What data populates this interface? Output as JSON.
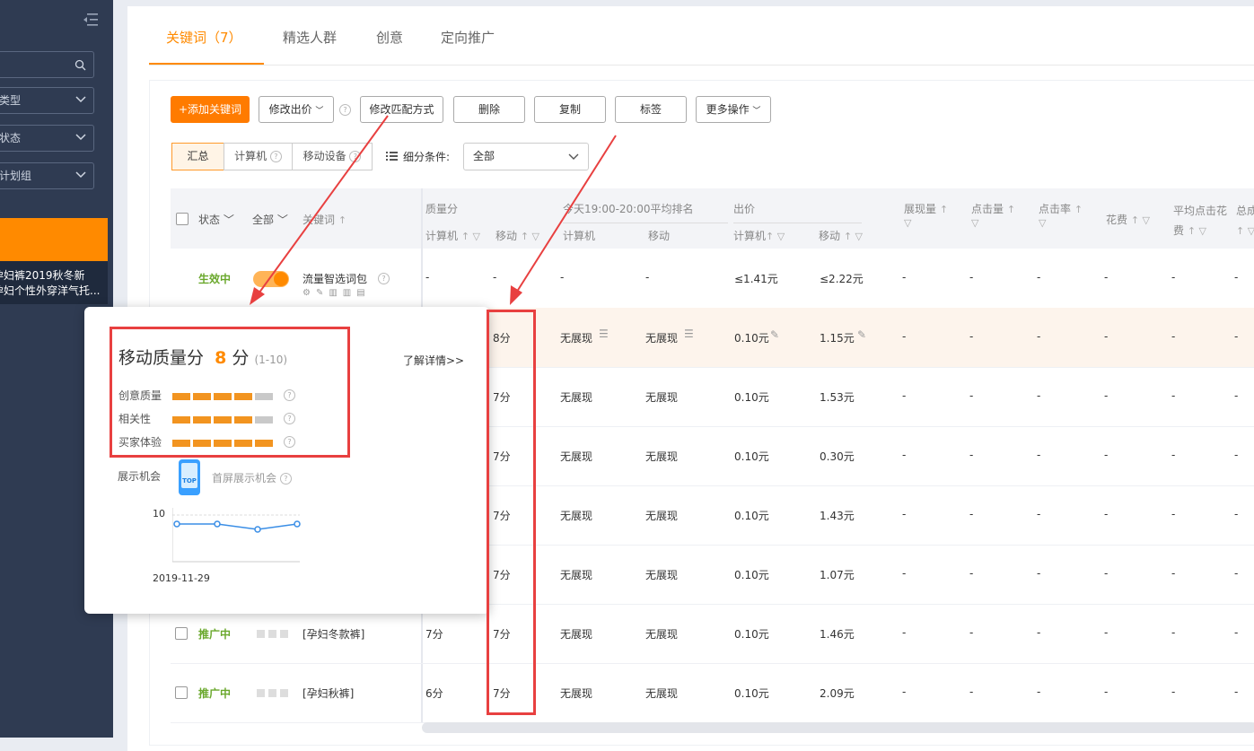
{
  "sidebar": {
    "type_select": "类型",
    "status_select": "状态",
    "plan_group_select": "计划组",
    "item_line1": "孕妇裤2019秋冬新",
    "item_line2": "孕妇个性外穿洋气托..."
  },
  "tabs": [
    {
      "label": "关键词（7）",
      "active": true
    },
    {
      "label": "精选人群"
    },
    {
      "label": "创意"
    },
    {
      "label": "定向推广"
    }
  ],
  "toolbar": {
    "add_keyword": "+添加关键词",
    "modify_bid": "修改出价",
    "modify_match": "修改匹配方式",
    "delete": "删除",
    "copy": "复制",
    "tag": "标签",
    "more": "更多操作"
  },
  "segments": {
    "summary": "汇总",
    "computer": "计算机",
    "mobile": "移动设备"
  },
  "filter": {
    "label": "细分条件:",
    "value": "全部"
  },
  "table_header": {
    "status": "状态",
    "all": "全部",
    "keyword": "关键词",
    "quality": "质量分",
    "computer": "计算机",
    "mobile": "移动",
    "rank": "今天19:00-20:00平均排名",
    "bid": "出价",
    "impressions": "展现量",
    "clicks": "点击量",
    "ctr": "点击率",
    "cost": "花费",
    "avg_cpc_1": "平均点击花",
    "avg_cpc_2": "费",
    "total": "总成"
  },
  "rows": [
    {
      "status": "生效中",
      "keyword": "流量智选词包",
      "q_pc": "-",
      "q_mobile": "-",
      "rank_pc": "-",
      "rank_mobile": "-",
      "bid_pc": "≤1.41元",
      "bid_mobile": "≤2.22元",
      "dash": "-"
    },
    {
      "q_mobile": "8分",
      "rank_pc": "无展现",
      "rank_mobile": "无展现",
      "bid_pc": "0.10元",
      "bid_mobile": "1.15元",
      "dash": "-"
    },
    {
      "q_mobile": "7分",
      "rank_pc": "无展现",
      "rank_mobile": "无展现",
      "bid_pc": "0.10元",
      "bid_mobile": "1.53元",
      "dash": "-"
    },
    {
      "q_mobile": "7分",
      "rank_pc": "无展现",
      "rank_mobile": "无展现",
      "bid_pc": "0.10元",
      "bid_mobile": "0.30元",
      "dash": "-"
    },
    {
      "q_mobile": "7分",
      "rank_pc": "无展现",
      "rank_mobile": "无展现",
      "bid_pc": "0.10元",
      "bid_mobile": "1.43元",
      "dash": "-"
    },
    {
      "q_mobile": "7分",
      "rank_pc": "无展现",
      "rank_mobile": "无展现",
      "bid_pc": "0.10元",
      "bid_mobile": "1.07元",
      "dash": "-"
    },
    {
      "status": "推广中",
      "keyword": "[孕妇冬款裤]",
      "q_pc": "7分",
      "q_mobile": "7分",
      "rank_pc": "无展现",
      "rank_mobile": "无展现",
      "bid_pc": "0.10元",
      "bid_mobile": "1.46元",
      "dash": "-"
    },
    {
      "status": "推广中",
      "keyword": "[孕妇秋裤]",
      "q_pc": "6分",
      "q_mobile": "7分",
      "rank_pc": "无展现",
      "rank_mobile": "无展现",
      "bid_pc": "0.10元",
      "bid_mobile": "2.09元",
      "dash": "-"
    }
  ],
  "popup": {
    "title": "移动质量分",
    "score": "8",
    "unit": "分",
    "range": "(1-10)",
    "learn_more": "了解详情>>",
    "metrics": [
      {
        "label": "创意质量",
        "level": 4
      },
      {
        "label": "相关性",
        "level": 4
      },
      {
        "label": "买家体验",
        "level": 5
      }
    ],
    "exposure_label": "展示机会",
    "top_badge": "TOP",
    "first_screen": "首屏展示机会",
    "chart_y": "10",
    "chart_x": "2019-11-29"
  },
  "colors": {
    "accent": "#ff8a00",
    "highlight": "#e84040",
    "sidebar": "#2f3b52"
  }
}
